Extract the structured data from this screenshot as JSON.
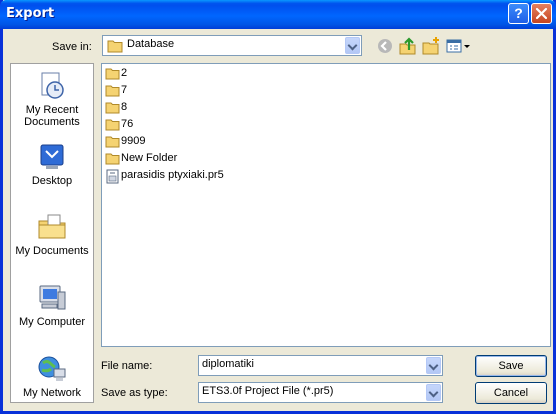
{
  "window": {
    "title": "Export"
  },
  "toolbar": {
    "save_in_label": "Save in:",
    "save_in_value": "Database"
  },
  "places": [
    {
      "label": "My Recent Documents"
    },
    {
      "label": "Desktop"
    },
    {
      "label": "My Documents"
    },
    {
      "label": "My Computer"
    },
    {
      "label": "My Network"
    }
  ],
  "files": [
    {
      "name": "2",
      "type": "folder"
    },
    {
      "name": "7",
      "type": "folder"
    },
    {
      "name": "8",
      "type": "folder"
    },
    {
      "name": "76",
      "type": "folder"
    },
    {
      "name": "9909",
      "type": "folder"
    },
    {
      "name": "New Folder",
      "type": "folder"
    },
    {
      "name": "parasidis ptyxiaki.pr5",
      "type": "file"
    }
  ],
  "form": {
    "file_name_label": "File name:",
    "file_name_value": "diplomatiki",
    "save_as_type_label": "Save as type:",
    "save_as_type_value": "ETS3.0f Project File (*.pr5)"
  },
  "buttons": {
    "save": "Save",
    "cancel": "Cancel"
  },
  "icons": {
    "help": "help-icon",
    "close": "close-icon",
    "back": "back-icon",
    "up": "up-folder-icon",
    "new_folder": "new-folder-icon",
    "views": "views-icon"
  },
  "colors": {
    "titlebar": "#0054e3",
    "face": "#ece9d8",
    "folder": "#f5d372"
  }
}
